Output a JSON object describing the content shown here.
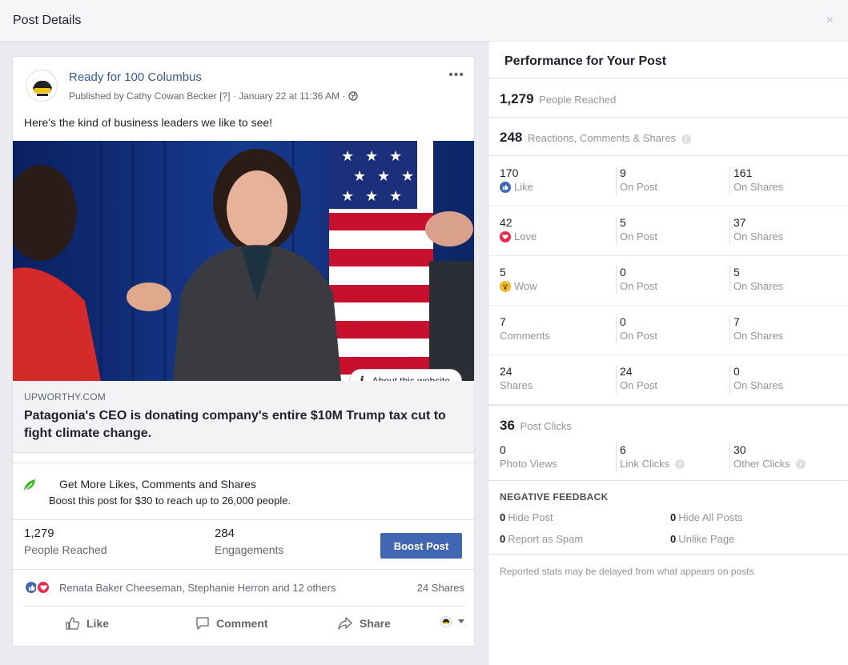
{
  "dialog": {
    "title": "Post Details",
    "close": "×"
  },
  "post": {
    "page_name": "Ready for 100 Columbus",
    "meta": "Published by Cathy Cowan Becker [?] · January 22 at 11:36 AM · ",
    "menu": "•••",
    "text": "Here's the kind of business leaders we like to see!",
    "about_site": "About this website",
    "link_domain": "UPWORTHY.COM",
    "link_title": "Patagonia's CEO is donating company's entire $10M Trump tax cut to fight climate change."
  },
  "boost": {
    "title": "Get More Likes, Comments and Shares",
    "subtitle": "Boost this post for $30 to reach up to 26,000 people.",
    "button": "Boost Post"
  },
  "stats": {
    "reached_value": "1,279",
    "reached_label": "People Reached",
    "engagements_value": "284",
    "engagements_label": "Engagements"
  },
  "reactions": {
    "names": "Renata Baker Cheeseman, Stephanie Herron and 12 others",
    "shares": "24 Shares"
  },
  "actions": {
    "like": "Like",
    "comment": "Comment",
    "share": "Share"
  },
  "performance": {
    "title": "Performance for Your Post",
    "reached_value": "1,279",
    "reached_label": "People Reached",
    "rcs_value": "248",
    "rcs_label": "Reactions, Comments & Shares",
    "rows": [
      {
        "total": "170",
        "label": "Like",
        "on_post": "9",
        "on_post_label": "On Post",
        "on_shares": "161",
        "on_shares_label": "On Shares"
      },
      {
        "total": "42",
        "label": "Love",
        "on_post": "5",
        "on_post_label": "On Post",
        "on_shares": "37",
        "on_shares_label": "On Shares"
      },
      {
        "total": "5",
        "label": "Wow",
        "on_post": "0",
        "on_post_label": "On Post",
        "on_shares": "5",
        "on_shares_label": "On Shares"
      },
      {
        "total": "7",
        "label": "Comments",
        "on_post": "0",
        "on_post_label": "On Post",
        "on_shares": "7",
        "on_shares_label": "On Shares"
      },
      {
        "total": "24",
        "label": "Shares",
        "on_post": "24",
        "on_post_label": "On Post",
        "on_shares": "0",
        "on_shares_label": "On Shares"
      }
    ],
    "clicks_value": "36",
    "clicks_label": "Post Clicks",
    "photo_views": "0",
    "photo_views_label": "Photo Views",
    "link_clicks": "6",
    "link_clicks_label": "Link Clicks",
    "other_clicks": "30",
    "other_clicks_label": "Other Clicks",
    "negative_title": "NEGATIVE FEEDBACK",
    "hide_post": "0",
    "hide_post_label": "Hide Post",
    "hide_all": "0",
    "hide_all_label": "Hide All Posts",
    "spam": "0",
    "spam_label": "Report as Spam",
    "unlike": "0",
    "unlike_label": "Unlike Page",
    "footnote": "Reported stats may be delayed from what appears on posts"
  },
  "colors": {
    "brand": "#4267b2",
    "link": "#365899",
    "love": "#f0284a",
    "boost_leaf": "#42b72a"
  }
}
